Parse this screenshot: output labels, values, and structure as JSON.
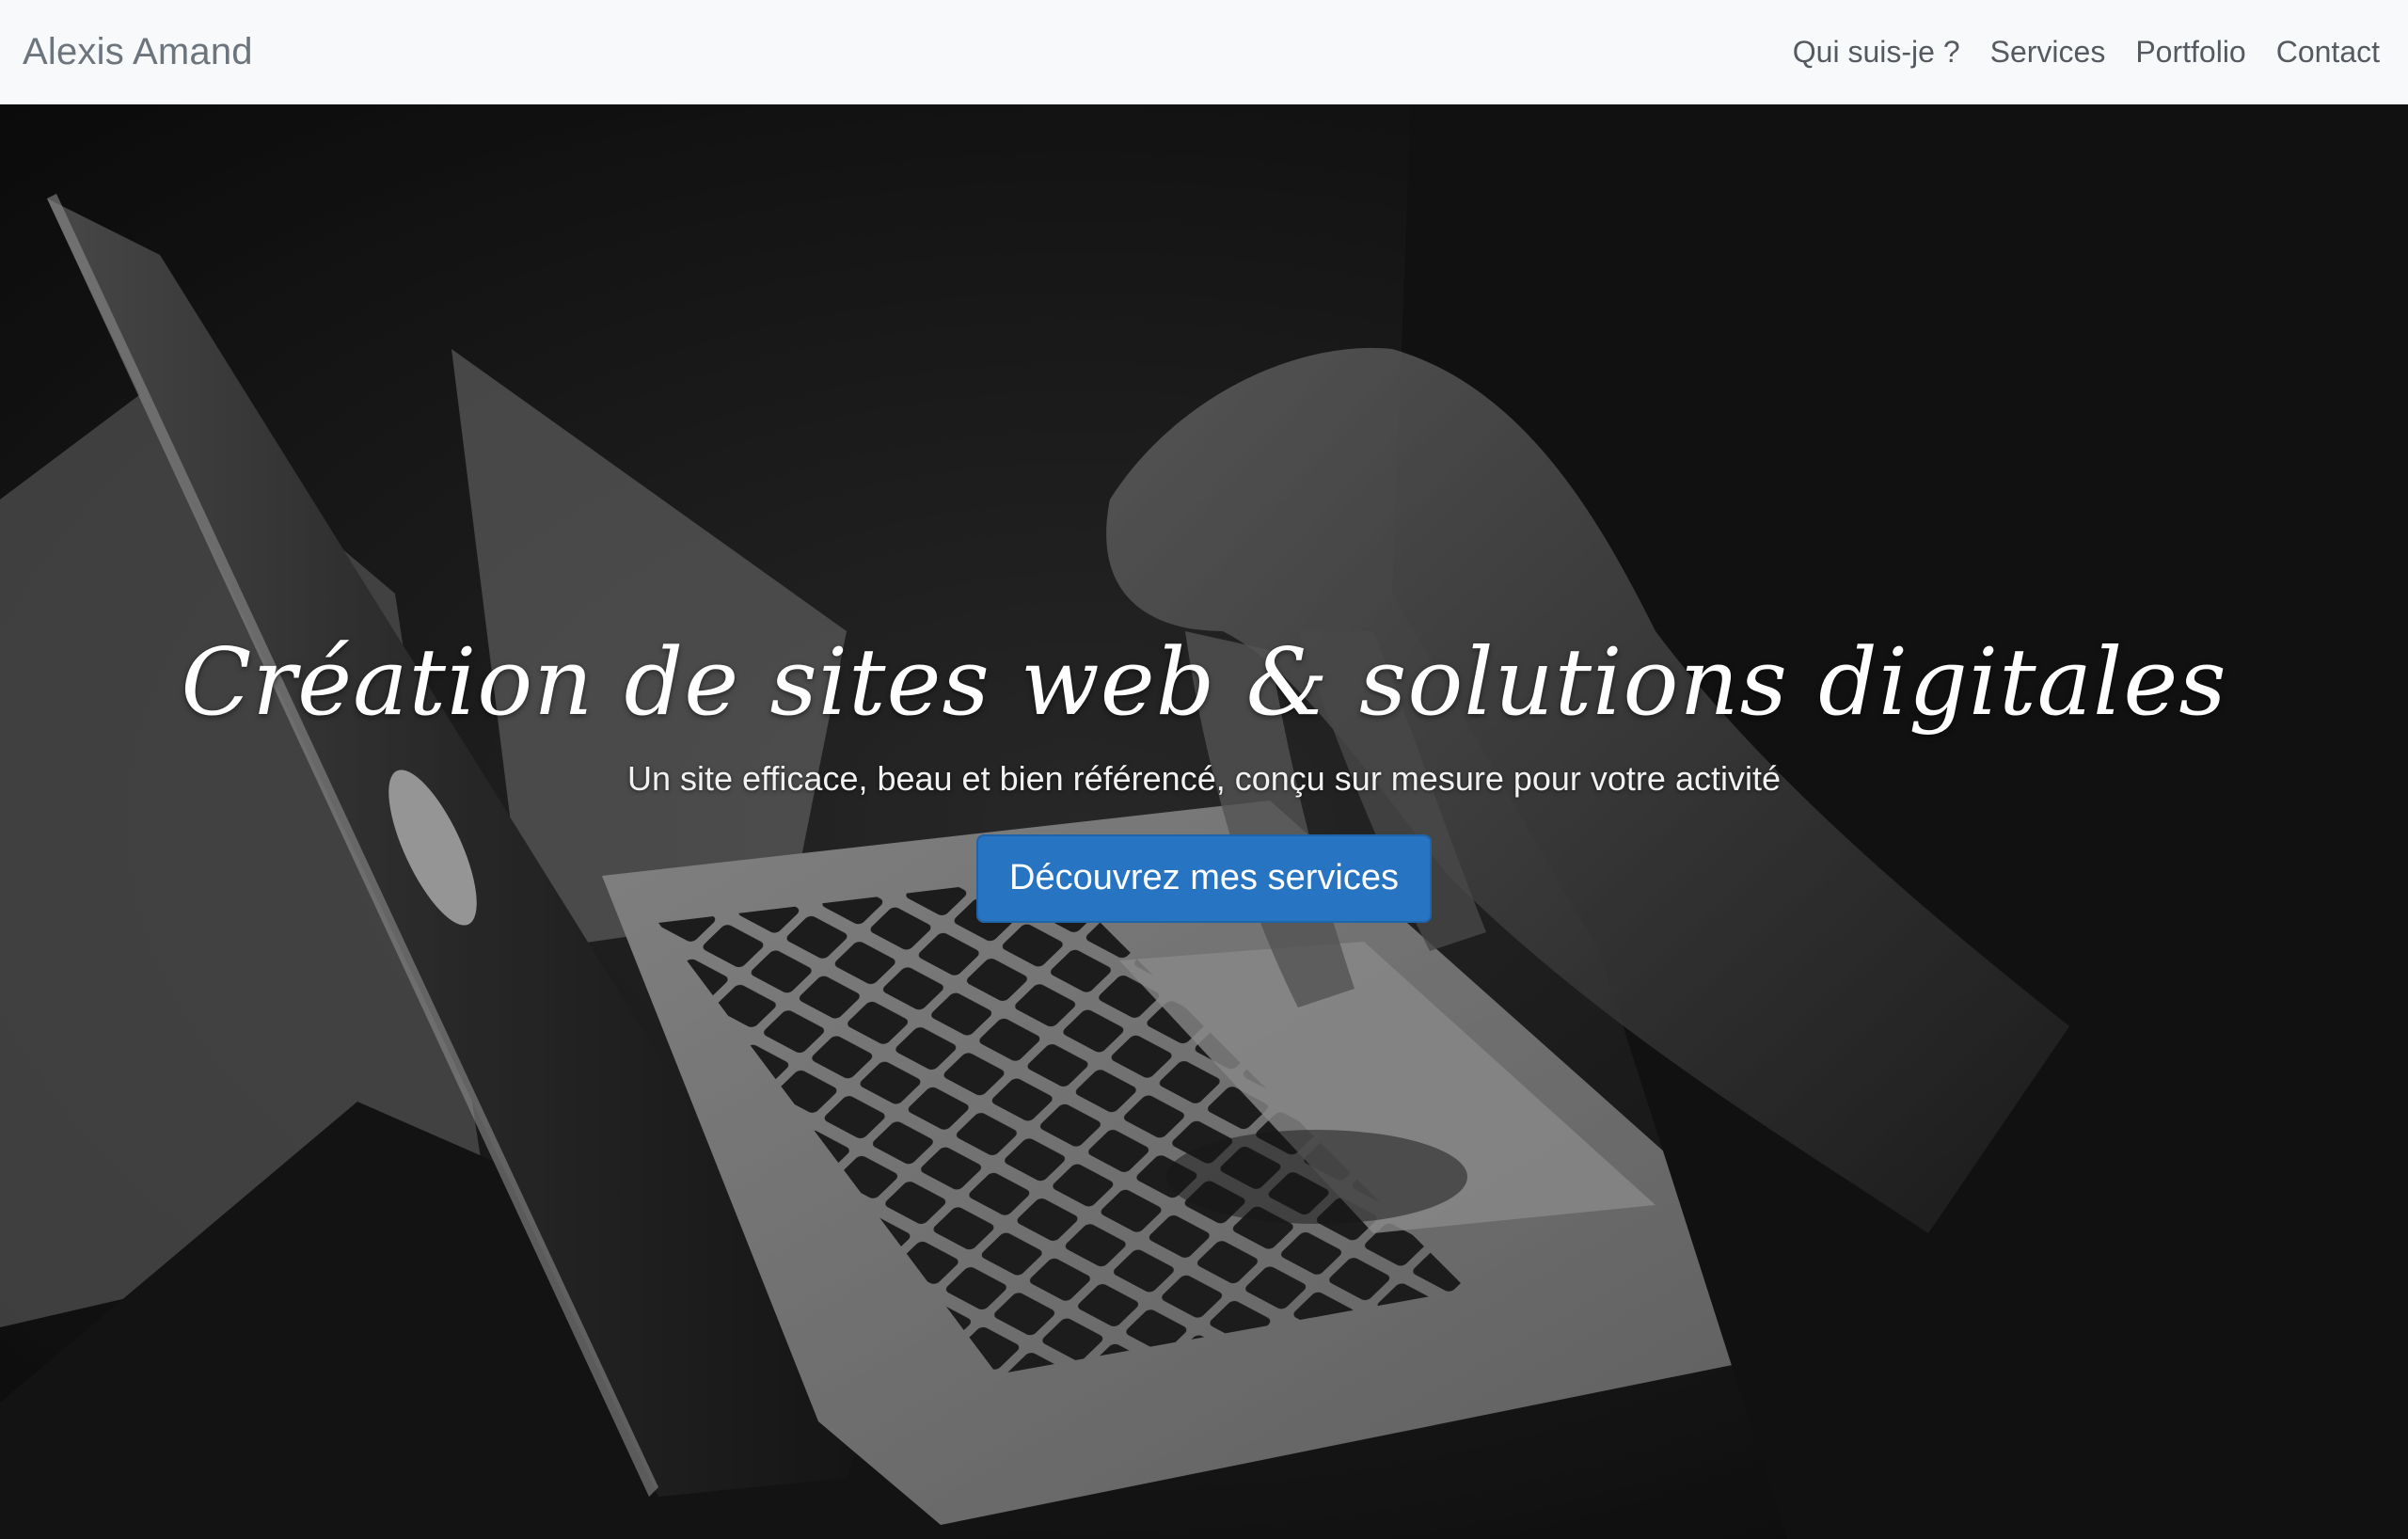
{
  "navbar": {
    "brand": "Alexis Amand",
    "links": [
      {
        "label": "Qui suis-je ?"
      },
      {
        "label": "Services"
      },
      {
        "label": "Portfolio"
      },
      {
        "label": "Contact"
      }
    ]
  },
  "hero": {
    "background_image": "laptop-typing-photo",
    "title": "Création de sites web & solutions digitales",
    "subtitle": "Un site efficace, beau et bien référencé, conçu sur mesure pour votre activité",
    "cta_label": "Découvrez mes services"
  },
  "colors": {
    "navbar_bg": "#f8f9fa",
    "brand_text": "#6c757d",
    "nav_text": "#555a60",
    "cta_bg": "#2774c2",
    "hero_text": "#ffffff"
  }
}
